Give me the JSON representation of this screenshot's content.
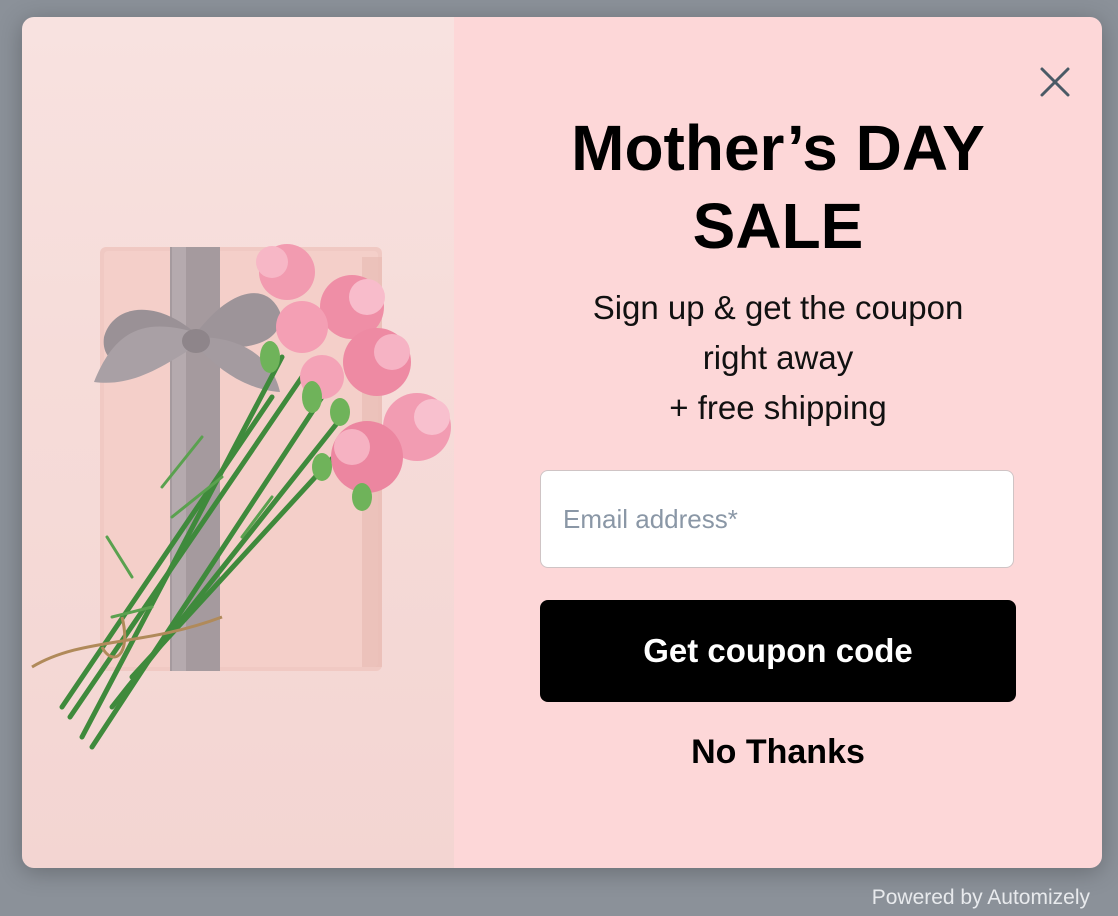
{
  "popup": {
    "headline_line1": "Mother’s DAY",
    "headline_line2": "SALE",
    "subtext_line1": "Sign up & get the coupon",
    "subtext_line2": "right away",
    "subtext_line3": "+ free shipping",
    "email_placeholder": "Email address*",
    "email_value": "",
    "cta_label": "Get coupon code",
    "dismiss_label": "No Thanks",
    "close_icon": "close-icon",
    "image_subject": "gift-box-with-carnations"
  },
  "footer": {
    "powered_by": "Powered by Automizely"
  },
  "colors": {
    "overlay": "#8b9199",
    "panel_background": "#fdd7d8",
    "button_background": "#000000",
    "button_text": "#ffffff",
    "close_icon": "#4a5a66"
  }
}
